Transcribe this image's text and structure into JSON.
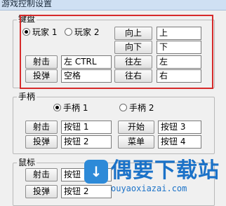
{
  "window": {
    "title": "游戏控制设置"
  },
  "keyboard": {
    "label": "键盘",
    "player1": "玩家 1",
    "player2": "玩家 2",
    "shoot_btn": "射击",
    "shoot_val": "左 CTRL",
    "bomb_btn": "投弹",
    "bomb_val": "空格",
    "up_btn": "向上",
    "up_val": "上",
    "down_btn": "向下",
    "down_val": "下",
    "left_btn": "往左",
    "left_val": "左",
    "right_btn": "往右",
    "right_val": "右"
  },
  "gamepad": {
    "label": "手柄",
    "pad1": "手柄 1",
    "pad2": "手柄 2",
    "shoot_btn": "射击",
    "shoot_val": "按钮 1",
    "bomb_btn": "投弹",
    "bomb_val": "按钮 2",
    "start_btn": "开始",
    "start_val": "按钮 3",
    "menu_btn": "菜单",
    "menu_val": "按钮 4"
  },
  "mouse": {
    "label": "鼠标",
    "shoot_btn": "射击",
    "shoot_val": "按钮 1",
    "bomb_btn": "投弹",
    "bomb_val": "按钮 2"
  },
  "watermark": {
    "title": "偶要下载站",
    "url": "ouyaoxiazai.com",
    "color": "#1b72c8"
  },
  "colors": {
    "highlight": "#d62a2a"
  }
}
